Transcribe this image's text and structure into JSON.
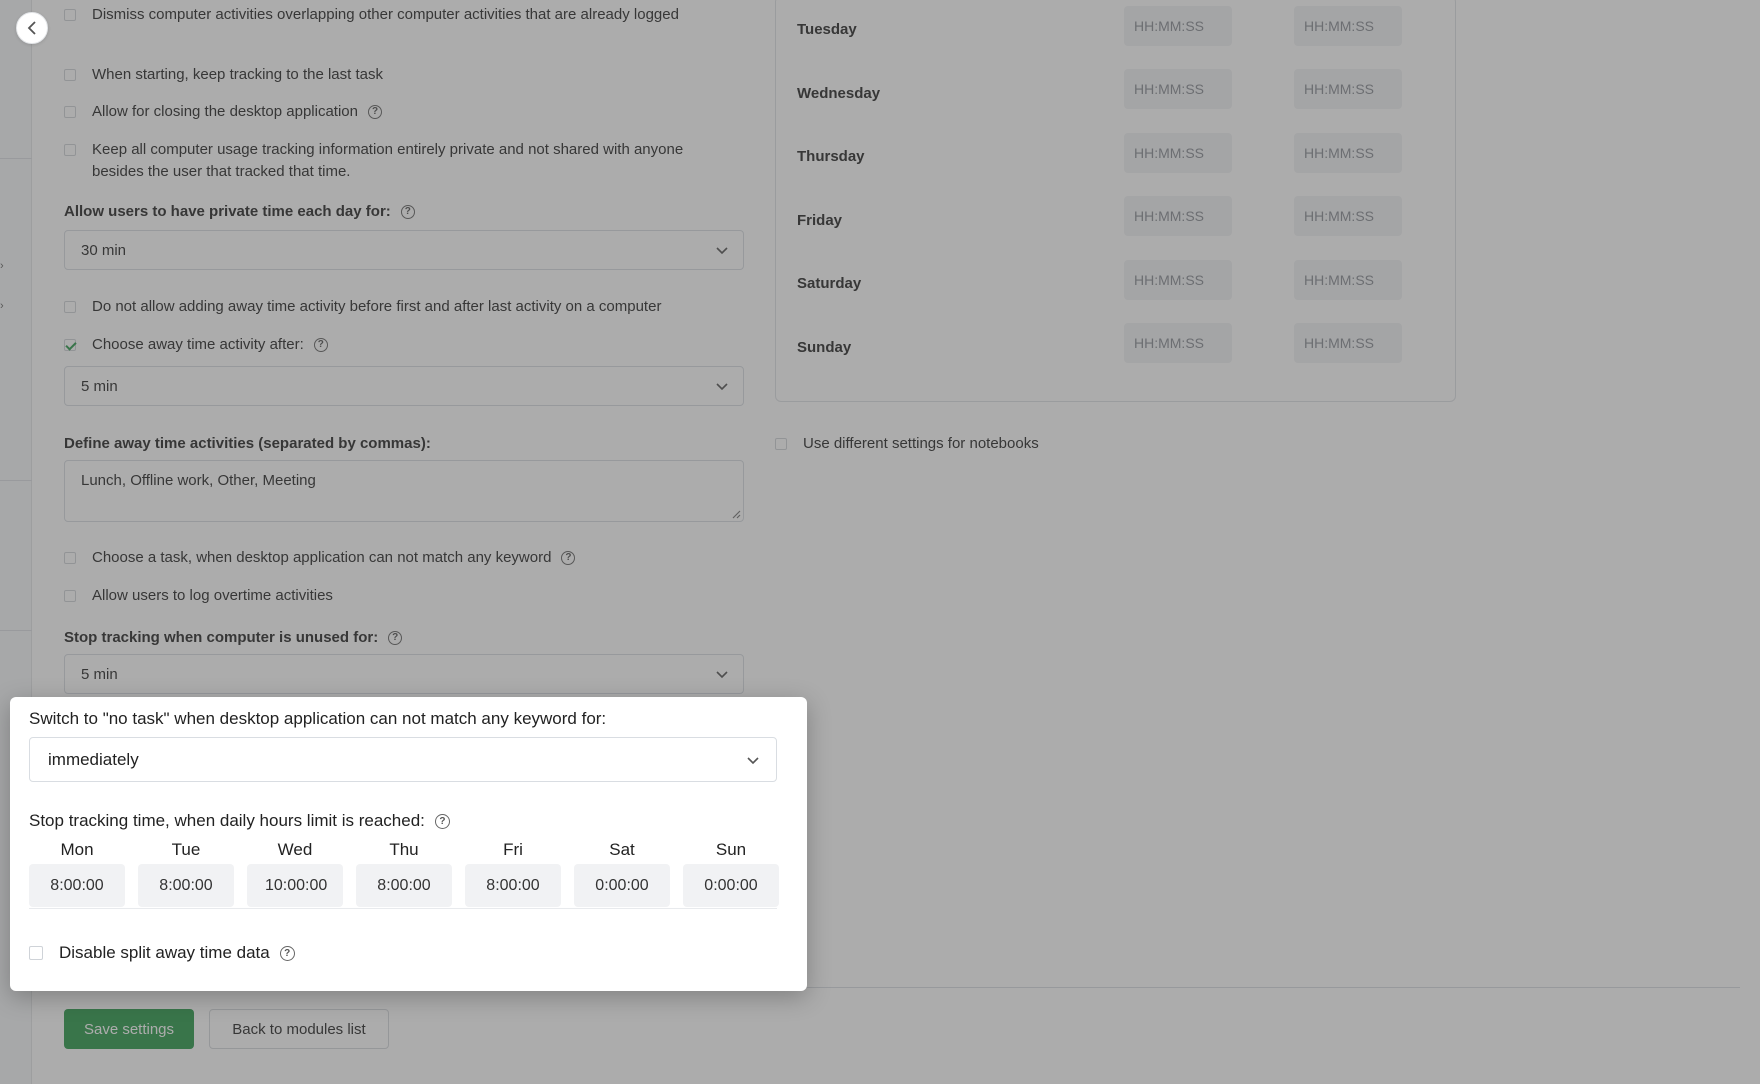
{
  "options": {
    "dismiss_overlapping": {
      "label": "Dismiss computer activities overlapping other computer activities that are already logged",
      "checked": false
    },
    "keep_last_task": {
      "label": "When starting, keep tracking to the last task",
      "checked": false
    },
    "allow_closing": {
      "label": "Allow for closing the desktop application",
      "checked": false
    },
    "keep_private": {
      "label": "Keep all computer usage tracking information entirely private and not shared with anyone besides the user that tracked that time.",
      "checked": false
    },
    "no_away_before_after": {
      "label": "Do not allow adding away time activity before first and after last activity on a computer",
      "checked": false
    },
    "choose_away_after": {
      "label": "Choose away time activity after:",
      "checked": true
    },
    "choose_task_no_keyword": {
      "label": "Choose a task, when desktop application can not match any keyword",
      "checked": false
    },
    "log_overtime": {
      "label": "Allow users to log overtime activities",
      "checked": false
    }
  },
  "private_time": {
    "label": "Allow users to have private time each day for:",
    "value": "30 min"
  },
  "away_after": {
    "value": "5 min"
  },
  "away_activities": {
    "label": "Define away time activities (separated by commas):",
    "value": "Lunch, Offline work, Other, Meeting"
  },
  "stop_unused": {
    "label": "Stop tracking when computer is unused for:",
    "value": "5 min"
  },
  "schedule": {
    "placeholder": "HH:MM:SS",
    "days": [
      "Tuesday",
      "Wednesday",
      "Thursday",
      "Friday",
      "Saturday",
      "Sunday"
    ]
  },
  "notebooks": {
    "label": "Use different settings for notebooks",
    "checked": false
  },
  "popup": {
    "no_task_label": "Switch to \"no task\" when desktop application can not match any keyword for:",
    "no_task_value": "immediately",
    "daily_limit_label": "Stop tracking time, when daily hours limit is reached:",
    "days": [
      {
        "day": "Mon",
        "value": "8:00:00"
      },
      {
        "day": "Tue",
        "value": "8:00:00"
      },
      {
        "day": "Wed",
        "value": "10:00:00"
      },
      {
        "day": "Thu",
        "value": "8:00:00"
      },
      {
        "day": "Fri",
        "value": "8:00:00"
      },
      {
        "day": "Sat",
        "value": "0:00:00"
      },
      {
        "day": "Sun",
        "value": "0:00:00"
      }
    ],
    "disable_split_label": "Disable split away time data"
  },
  "buttons": {
    "save": "Save settings",
    "back": "Back to modules list"
  },
  "colors": {
    "accent": "#2e9b4d",
    "overlay": "#464646"
  }
}
